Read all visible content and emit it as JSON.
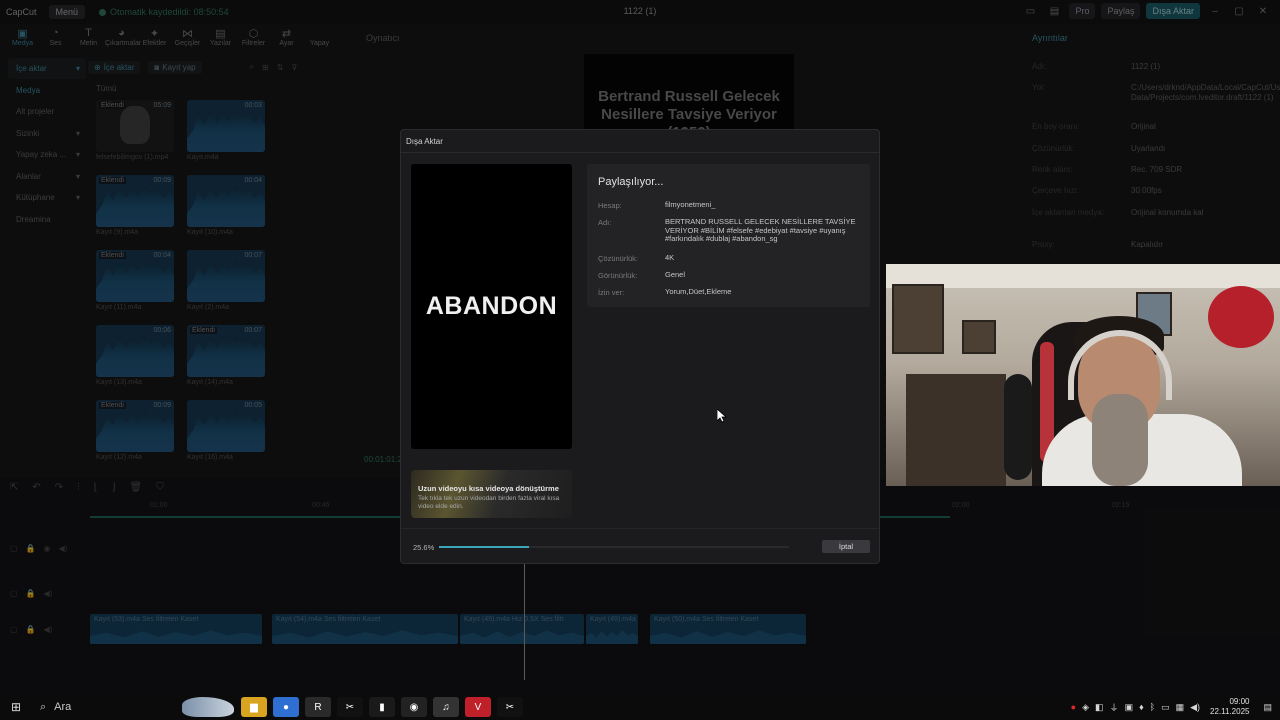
{
  "titlebar": {
    "logo": "CapCut",
    "menu_label": "Menü",
    "autosave": "Otomatik kaydedildi: 08:50:54",
    "project_title": "1122 (1)",
    "pro_label": "Pro",
    "share_label": "Paylaş",
    "export_label": "Dışa Aktar"
  },
  "tool_tabs": [
    {
      "label": "Medya",
      "icon": "▣"
    },
    {
      "label": "Ses",
      "icon": "◔"
    },
    {
      "label": "Metin",
      "icon": "T"
    },
    {
      "label": "Çıkartmalar",
      "icon": "◕"
    },
    {
      "label": "Efektler",
      "icon": "✦"
    },
    {
      "label": "Geçişler",
      "icon": "⋈"
    },
    {
      "label": "Yazılar",
      "icon": "▤"
    },
    {
      "label": "Filtreler",
      "icon": "⬡"
    },
    {
      "label": "Ayar",
      "icon": "⇄"
    },
    {
      "label": "Yapay",
      "icon": ""
    }
  ],
  "sidebar": {
    "items": [
      {
        "label": "İçe aktar",
        "arrow": "▾"
      },
      {
        "label": "Medya",
        "arrow": ""
      },
      {
        "label": "Alt projeler",
        "arrow": ""
      },
      {
        "label": "Sizinki",
        "arrow": "▾"
      },
      {
        "label": "Yapay zeka ...",
        "arrow": "▾"
      },
      {
        "label": "Alanlar",
        "arrow": "▾"
      },
      {
        "label": "Kütüphane",
        "arrow": "▾"
      },
      {
        "label": "Dreamina",
        "arrow": ""
      }
    ]
  },
  "media": {
    "import_label": "İçe aktar",
    "record_label": "Kayıt yap",
    "filter_all": "Tümü",
    "items": [
      {
        "name": "felsefebilimgov (1).mp4",
        "duration": "05:09",
        "badge": "Eklendi",
        "kind": "video"
      },
      {
        "name": "Kayıt.m4a",
        "duration": "00:03",
        "badge": "",
        "kind": "audio"
      },
      {
        "name": "Kayıt (9).m4a",
        "duration": "00:09",
        "badge": "Eklendi",
        "kind": "audio"
      },
      {
        "name": "Kayıt (10).m4a",
        "duration": "00:04",
        "badge": "",
        "kind": "audio"
      },
      {
        "name": "Kayıt (11).m4a",
        "duration": "00:04",
        "badge": "Eklendi",
        "kind": "audio"
      },
      {
        "name": "Kayıt (2).m4a",
        "duration": "00:07",
        "badge": "",
        "kind": "audio"
      },
      {
        "name": "Kayıt (13).m4a",
        "duration": "00:06",
        "badge": "",
        "kind": "audio"
      },
      {
        "name": "Kayıt (14).m4a",
        "duration": "00:07",
        "badge": "Eklendi",
        "kind": "audio"
      },
      {
        "name": "Kayıt (12).m4a",
        "duration": "00:09",
        "badge": "Eklendi",
        "kind": "audio"
      },
      {
        "name": "Kayıt (16).m4a",
        "duration": "00:05",
        "badge": "",
        "kind": "audio"
      }
    ]
  },
  "player": {
    "header": "Oynatıcı",
    "preview_text": "Bertrand Russell Gelecek Nesillere Tavsiye Veriyor (1959)",
    "timecode": "00:01:01:21"
  },
  "properties": {
    "header": "Ayrıntılar",
    "rows": [
      {
        "key": "Adı:",
        "value": "1122 (1)"
      },
      {
        "key": "Yol:",
        "value": "C:/Users/drknd/AppData/Local/CapCut/User Data/Projects/com.lveditor.draft/1122 (1)"
      },
      {
        "key": "En boy oranı:",
        "value": "Orijinal"
      },
      {
        "key": "Çözünürlük:",
        "value": "Uyarlandı"
      },
      {
        "key": "Renk alanı:",
        "value": "Rec. 709 SDR"
      },
      {
        "key": "Çerçeve hızı:",
        "value": "30.00fps"
      },
      {
        "key": "İçe aktarılan medya:",
        "value": "Orijinal konumda kal"
      },
      {
        "key": "Proxy:",
        "value": "Kapalıdır"
      }
    ]
  },
  "timeline": {
    "ruler": [
      "01:00",
      "00:45",
      "02:00",
      "02:15"
    ],
    "clips": [
      {
        "label": "Kayıt (53).m4a   Ses filtreleri Kaset"
      },
      {
        "label": "Kayıt (54).m4a   Ses filtreleri Kaset"
      },
      {
        "label": "Kayıt (49).m4a   Hız 0.5X   Ses filtr"
      },
      {
        "label": "Kayıt (49).m4a"
      },
      {
        "label": "Kayıt (50).m4a   Ses filtreleri Kaset"
      }
    ]
  },
  "dialog": {
    "title": "Dışa Aktar",
    "thumbnail_text": "ABANDON",
    "status": "Paylaşılıyor...",
    "rows": [
      {
        "key": "Hesap:",
        "value": "filmyonetmeni_"
      },
      {
        "key": "Adı:",
        "value": "BERTRAND RUSSELL GELECEK NESİLLERE TAVSİYE VERİYOR #BİLİM #felsefe #edebiyat #tavsiye #uyanış #farkındalık #dublaj #abandon_sg"
      },
      {
        "key": "Çözünürlük:",
        "value": "4K"
      },
      {
        "key": "Görünürlük:",
        "value": "Genel"
      },
      {
        "key": "İzin ver:",
        "value": "Yorum,Düet,Ekleme"
      }
    ],
    "promo_title": "Uzun videoyu kısa videoya dönüştürme",
    "promo_subtitle": "Tek tıkla tek uzun videodan birden fazla viral kısa video elde edin.",
    "progress_label": "25.6%",
    "progress_value": 0.256,
    "cancel_label": "İptal"
  },
  "taskbar": {
    "search_label": "Ara",
    "time": "09:00",
    "date": "22.11.2025",
    "apps": [
      {
        "name": "file-explorer",
        "glyph": "▆",
        "color": "#d9a520"
      },
      {
        "name": "chrome",
        "glyph": "●",
        "color": "#2f6fd1"
      },
      {
        "name": "r-app",
        "glyph": "R",
        "color": "#2a2a2a"
      },
      {
        "name": "capcut",
        "glyph": "✂",
        "color": "#111111"
      },
      {
        "name": "mouse-app",
        "glyph": "▮",
        "color": "#1a1a1a"
      },
      {
        "name": "obs",
        "glyph": "◉",
        "color": "#222222"
      },
      {
        "name": "microphone-app",
        "glyph": "♫",
        "color": "#333333"
      },
      {
        "name": "voicemeeter",
        "glyph": "V",
        "color": "#c0202a"
      },
      {
        "name": "capcut-2",
        "glyph": "✂",
        "color": "#111111"
      }
    ]
  },
  "colors": {
    "accent": "#3aa6b8",
    "progress": "#3aa6b8",
    "dialog_bg": "#1b1b1d"
  }
}
